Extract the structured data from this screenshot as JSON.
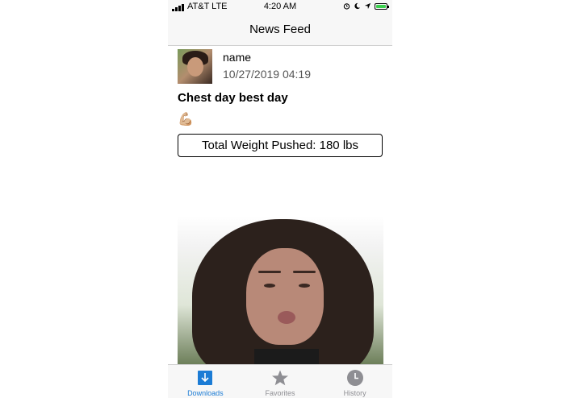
{
  "status_bar": {
    "carrier": "AT&T LTE",
    "time": "4:20 AM"
  },
  "nav": {
    "title": "News Feed"
  },
  "post": {
    "user_name": "name",
    "date": "10/27/2019 04:19",
    "title": "Chest day best day",
    "emoji": "💪🏼",
    "weight_label": "Total Weight Pushed: 180 lbs"
  },
  "tabs": [
    {
      "label": "Downloads",
      "icon": "downloads-icon",
      "active": true
    },
    {
      "label": "Favorites",
      "icon": "star-icon",
      "active": false
    },
    {
      "label": "History",
      "icon": "clock-icon",
      "active": false
    }
  ],
  "colors": {
    "accent": "#1c7cd5",
    "inactive": "#8e8e93",
    "battery": "#3bcf4e"
  }
}
